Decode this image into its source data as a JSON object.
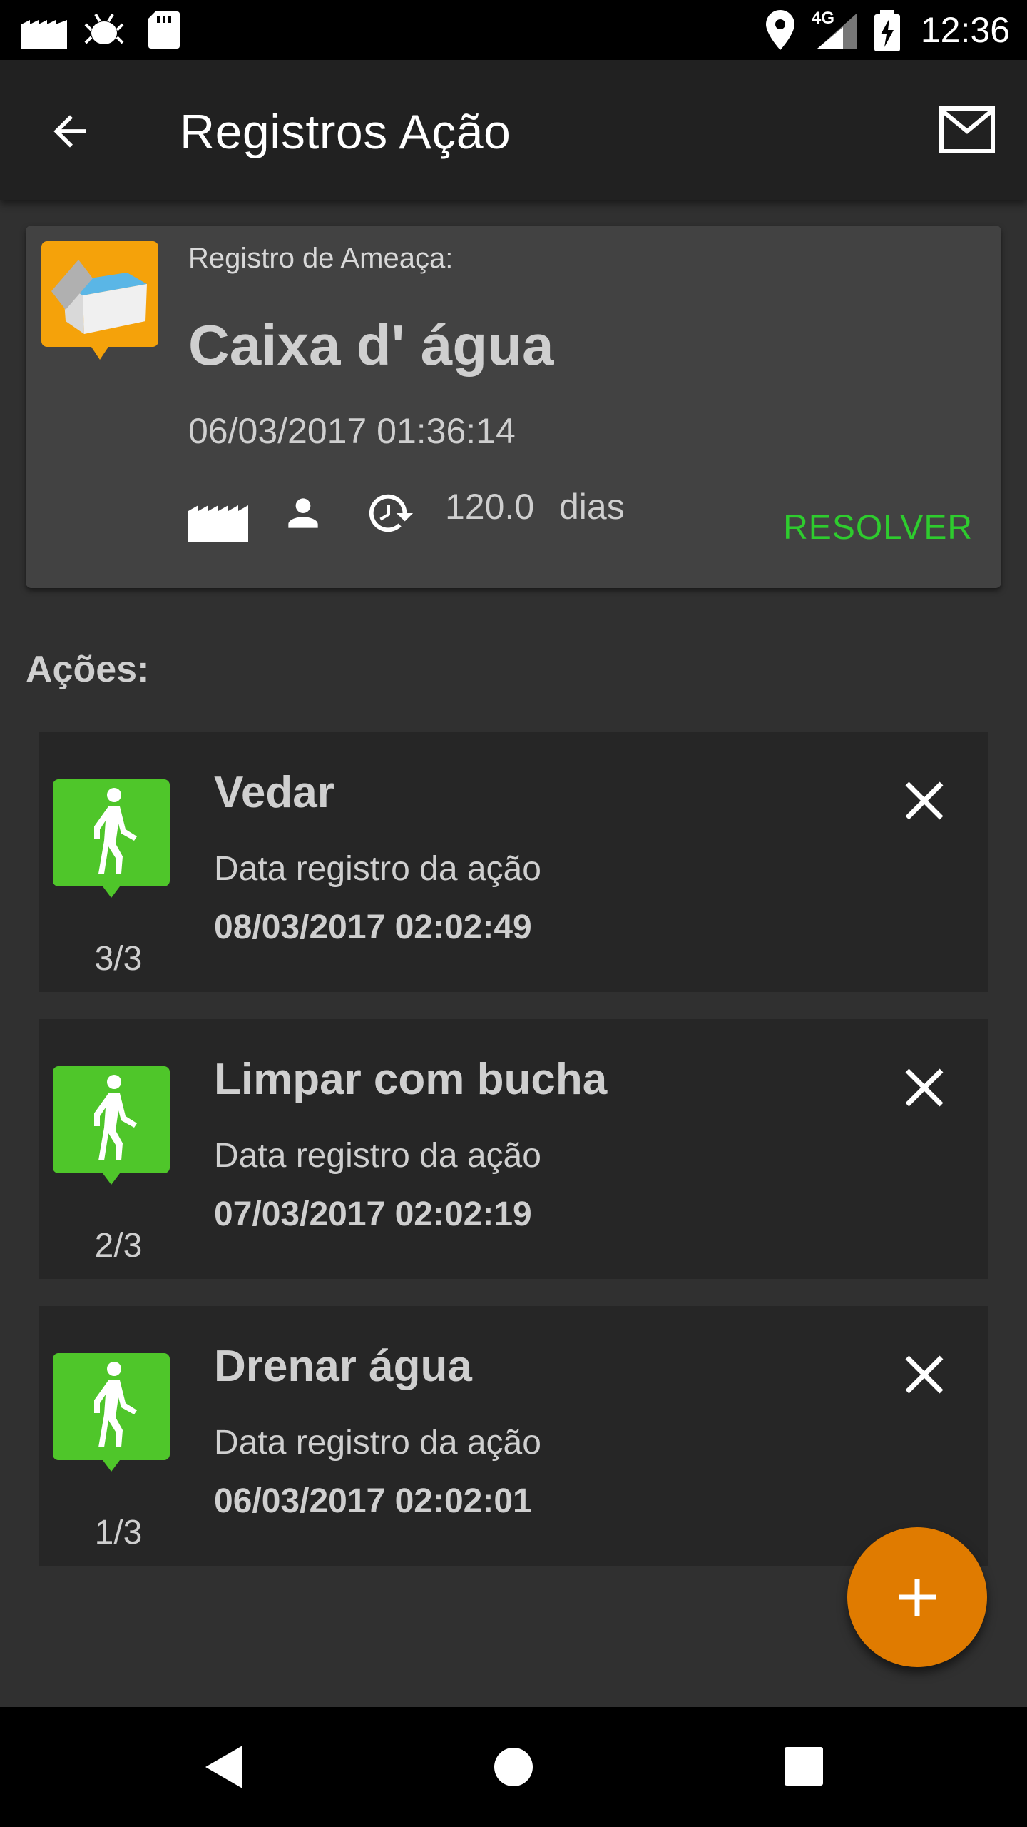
{
  "status_bar": {
    "time": "12:36",
    "network": "4G"
  },
  "app_bar": {
    "title": "Registros Ação",
    "back_icon": "arrow-back-icon",
    "mail_icon": "mail-icon"
  },
  "threat": {
    "label": "Registro de Ameaça:",
    "name": "Caixa d' água",
    "datetime": "06/03/2017 01:36:14",
    "days_value": "120.0",
    "days_unit": "dias",
    "resolve_label": "RESOLVER",
    "resolve_color": "#2ecc2e",
    "icon": "water-tank-icon"
  },
  "actions_title": "Ações:",
  "actions": [
    {
      "name": "Vedar",
      "label": "Data registro da ação",
      "date": "08/03/2017 02:02:49",
      "count": "3/3"
    },
    {
      "name": "Limpar com bucha",
      "label": "Data registro da ação",
      "date": "07/03/2017 02:02:19",
      "count": "2/3"
    },
    {
      "name": "Drenar água",
      "label": "Data registro da ação",
      "date": "06/03/2017 02:02:01",
      "count": "1/3"
    }
  ],
  "colors": {
    "accent": "#e07b00",
    "action_icon_bg": "#4fc62a",
    "threat_icon_bg": "#f5a20a"
  }
}
